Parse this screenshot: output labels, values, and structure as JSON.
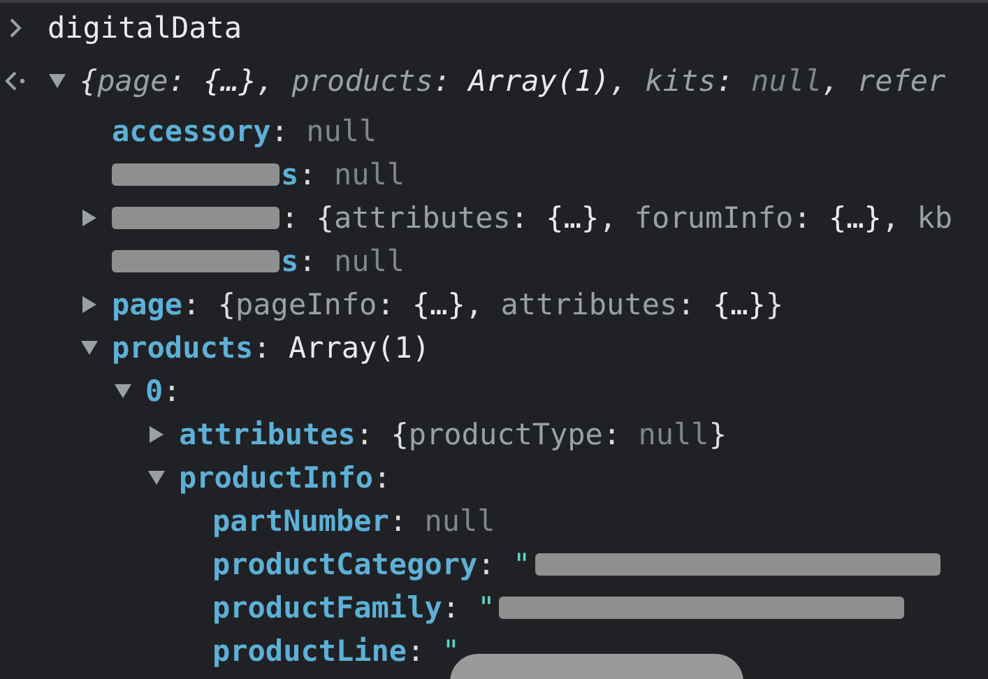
{
  "console": {
    "input": {
      "text": "digitalData"
    },
    "result": {
      "expanded": true,
      "preview": [
        {
          "kind": "punct",
          "text": "{"
        },
        {
          "kind": "key",
          "text": "page"
        },
        {
          "kind": "punct",
          "text": ": "
        },
        {
          "kind": "value",
          "text": "{…}"
        },
        {
          "kind": "punct",
          "text": ", "
        },
        {
          "kind": "key",
          "text": "products"
        },
        {
          "kind": "punct",
          "text": ": "
        },
        {
          "kind": "value",
          "text": "Array(1)"
        },
        {
          "kind": "punct",
          "text": ", "
        },
        {
          "kind": "key",
          "text": "kits"
        },
        {
          "kind": "punct",
          "text": ": "
        },
        {
          "kind": "null",
          "text": "null"
        },
        {
          "kind": "punct",
          "text": ", "
        },
        {
          "kind": "key",
          "text": "refer"
        }
      ]
    },
    "properties": [
      {
        "key": "accessory",
        "value": [
          {
            "kind": "punct",
            "text": ": "
          },
          {
            "kind": "null",
            "text": "null"
          }
        ]
      },
      {
        "key": "s",
        "key_redacted": true,
        "value": [
          {
            "kind": "punct",
            "text": ": "
          },
          {
            "kind": "null",
            "text": "null"
          }
        ]
      },
      {
        "key_redacted": true,
        "expanded": false,
        "value": [
          {
            "kind": "punct",
            "text": ": {"
          },
          {
            "kind": "key",
            "text": "attributes"
          },
          {
            "kind": "punct",
            "text": ": "
          },
          {
            "kind": "value",
            "text": "{…}"
          },
          {
            "kind": "punct",
            "text": ", "
          },
          {
            "kind": "key",
            "text": "forumInfo"
          },
          {
            "kind": "punct",
            "text": ": "
          },
          {
            "kind": "value",
            "text": "{…}"
          },
          {
            "kind": "punct",
            "text": ", "
          },
          {
            "kind": "key",
            "text": "kb"
          }
        ]
      },
      {
        "key": "s",
        "key_redacted": true,
        "value": [
          {
            "kind": "punct",
            "text": ": "
          },
          {
            "kind": "null",
            "text": "null"
          }
        ]
      },
      {
        "key": "page",
        "expanded": false,
        "value": [
          {
            "kind": "punct",
            "text": ": {"
          },
          {
            "kind": "key",
            "text": "pageInfo"
          },
          {
            "kind": "punct",
            "text": ": "
          },
          {
            "kind": "value",
            "text": "{…}"
          },
          {
            "kind": "punct",
            "text": ", "
          },
          {
            "kind": "key",
            "text": "attributes"
          },
          {
            "kind": "punct",
            "text": ": "
          },
          {
            "kind": "value",
            "text": "{…}"
          },
          {
            "kind": "punct",
            "text": "}"
          }
        ]
      },
      {
        "key": "products",
        "expanded": true,
        "value": [
          {
            "kind": "punct",
            "text": ": "
          },
          {
            "kind": "value",
            "text": "Array(1)"
          }
        ],
        "children": [
          {
            "key": "0",
            "expanded": true,
            "value": [
              {
                "kind": "punct",
                "text": ":"
              }
            ],
            "children": [
              {
                "key": "attributes",
                "expanded": false,
                "value": [
                  {
                    "kind": "punct",
                    "text": ": {"
                  },
                  {
                    "kind": "key",
                    "text": "productType"
                  },
                  {
                    "kind": "punct",
                    "text": ": "
                  },
                  {
                    "kind": "null",
                    "text": "null"
                  },
                  {
                    "kind": "punct",
                    "text": "}"
                  }
                ]
              },
              {
                "key": "productInfo",
                "expanded": true,
                "value": [
                  {
                    "kind": "punct",
                    "text": ":"
                  }
                ],
                "children": [
                  {
                    "key": "partNumber",
                    "value": [
                      {
                        "kind": "punct",
                        "text": ": "
                      },
                      {
                        "kind": "null",
                        "text": "null"
                      }
                    ]
                  },
                  {
                    "key": "productCategory",
                    "value_redacted": true,
                    "value": [
                      {
                        "kind": "punct",
                        "text": ": "
                      },
                      {
                        "kind": "string",
                        "text": "\""
                      }
                    ]
                  },
                  {
                    "key": "productFamily",
                    "value_redacted": true,
                    "value": [
                      {
                        "kind": "punct",
                        "text": ": "
                      },
                      {
                        "kind": "string",
                        "text": "\""
                      }
                    ]
                  },
                  {
                    "key": "productLine",
                    "obscured": true,
                    "value": [
                      {
                        "kind": "punct",
                        "text": ": "
                      },
                      {
                        "kind": "string",
                        "text": "\""
                      }
                    ]
                  }
                ]
              }
            ]
          }
        ]
      }
    ]
  }
}
